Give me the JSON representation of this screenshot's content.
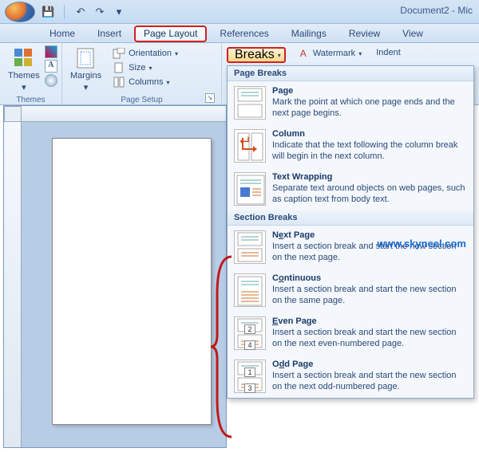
{
  "window": {
    "title": "Document2 - Mic"
  },
  "qat": {
    "save": "💾",
    "undo": "↶",
    "redo": "↷"
  },
  "tabs": {
    "home": "Home",
    "insert": "Insert",
    "page_layout": "Page Layout",
    "references": "References",
    "mailings": "Mailings",
    "review": "Review",
    "view": "View"
  },
  "ribbon": {
    "themes": {
      "label": "Themes",
      "btn": "Themes"
    },
    "page_setup": {
      "label": "Page Setup",
      "margins": "Margins",
      "orientation": "Orientation",
      "size": "Size",
      "columns": "Columns",
      "breaks": "Breaks"
    },
    "page_background": {
      "watermark": "Watermark",
      "indent": "Indent"
    }
  },
  "dropdown": {
    "page_breaks_header": "Page Breaks",
    "section_breaks_header": "Section Breaks",
    "items": {
      "page": {
        "title": "Page",
        "desc": "Mark the point at which one page ends and the next page begins."
      },
      "column": {
        "title": "Column",
        "desc": "Indicate that the text following the column break will begin in the next column."
      },
      "text_wrapping": {
        "title": "Text Wrapping",
        "desc": "Separate text around objects on web pages, such as caption text from body text."
      },
      "next_page": {
        "title_pre": "N",
        "title_u": "e",
        "title_post": "xt Page",
        "desc": "Insert a section break and start the new section on the next page."
      },
      "continuous": {
        "title_pre": "C",
        "title_u": "o",
        "title_post": "ntinuous",
        "desc": "Insert a section break and start the new section on the same page."
      },
      "even_page": {
        "title_pre": "",
        "title_u": "E",
        "title_post": "ven Page",
        "desc": "Insert a section break and start the new section on the next even-numbered page.",
        "num1": "2",
        "num2": "4"
      },
      "odd_page": {
        "title_pre": "O",
        "title_u": "d",
        "title_post": "d Page",
        "desc": "Insert a section break and start the new section on the next odd-numbered page.",
        "num1": "1",
        "num2": "3"
      }
    }
  },
  "watermark_url": "www.skyneel.com"
}
